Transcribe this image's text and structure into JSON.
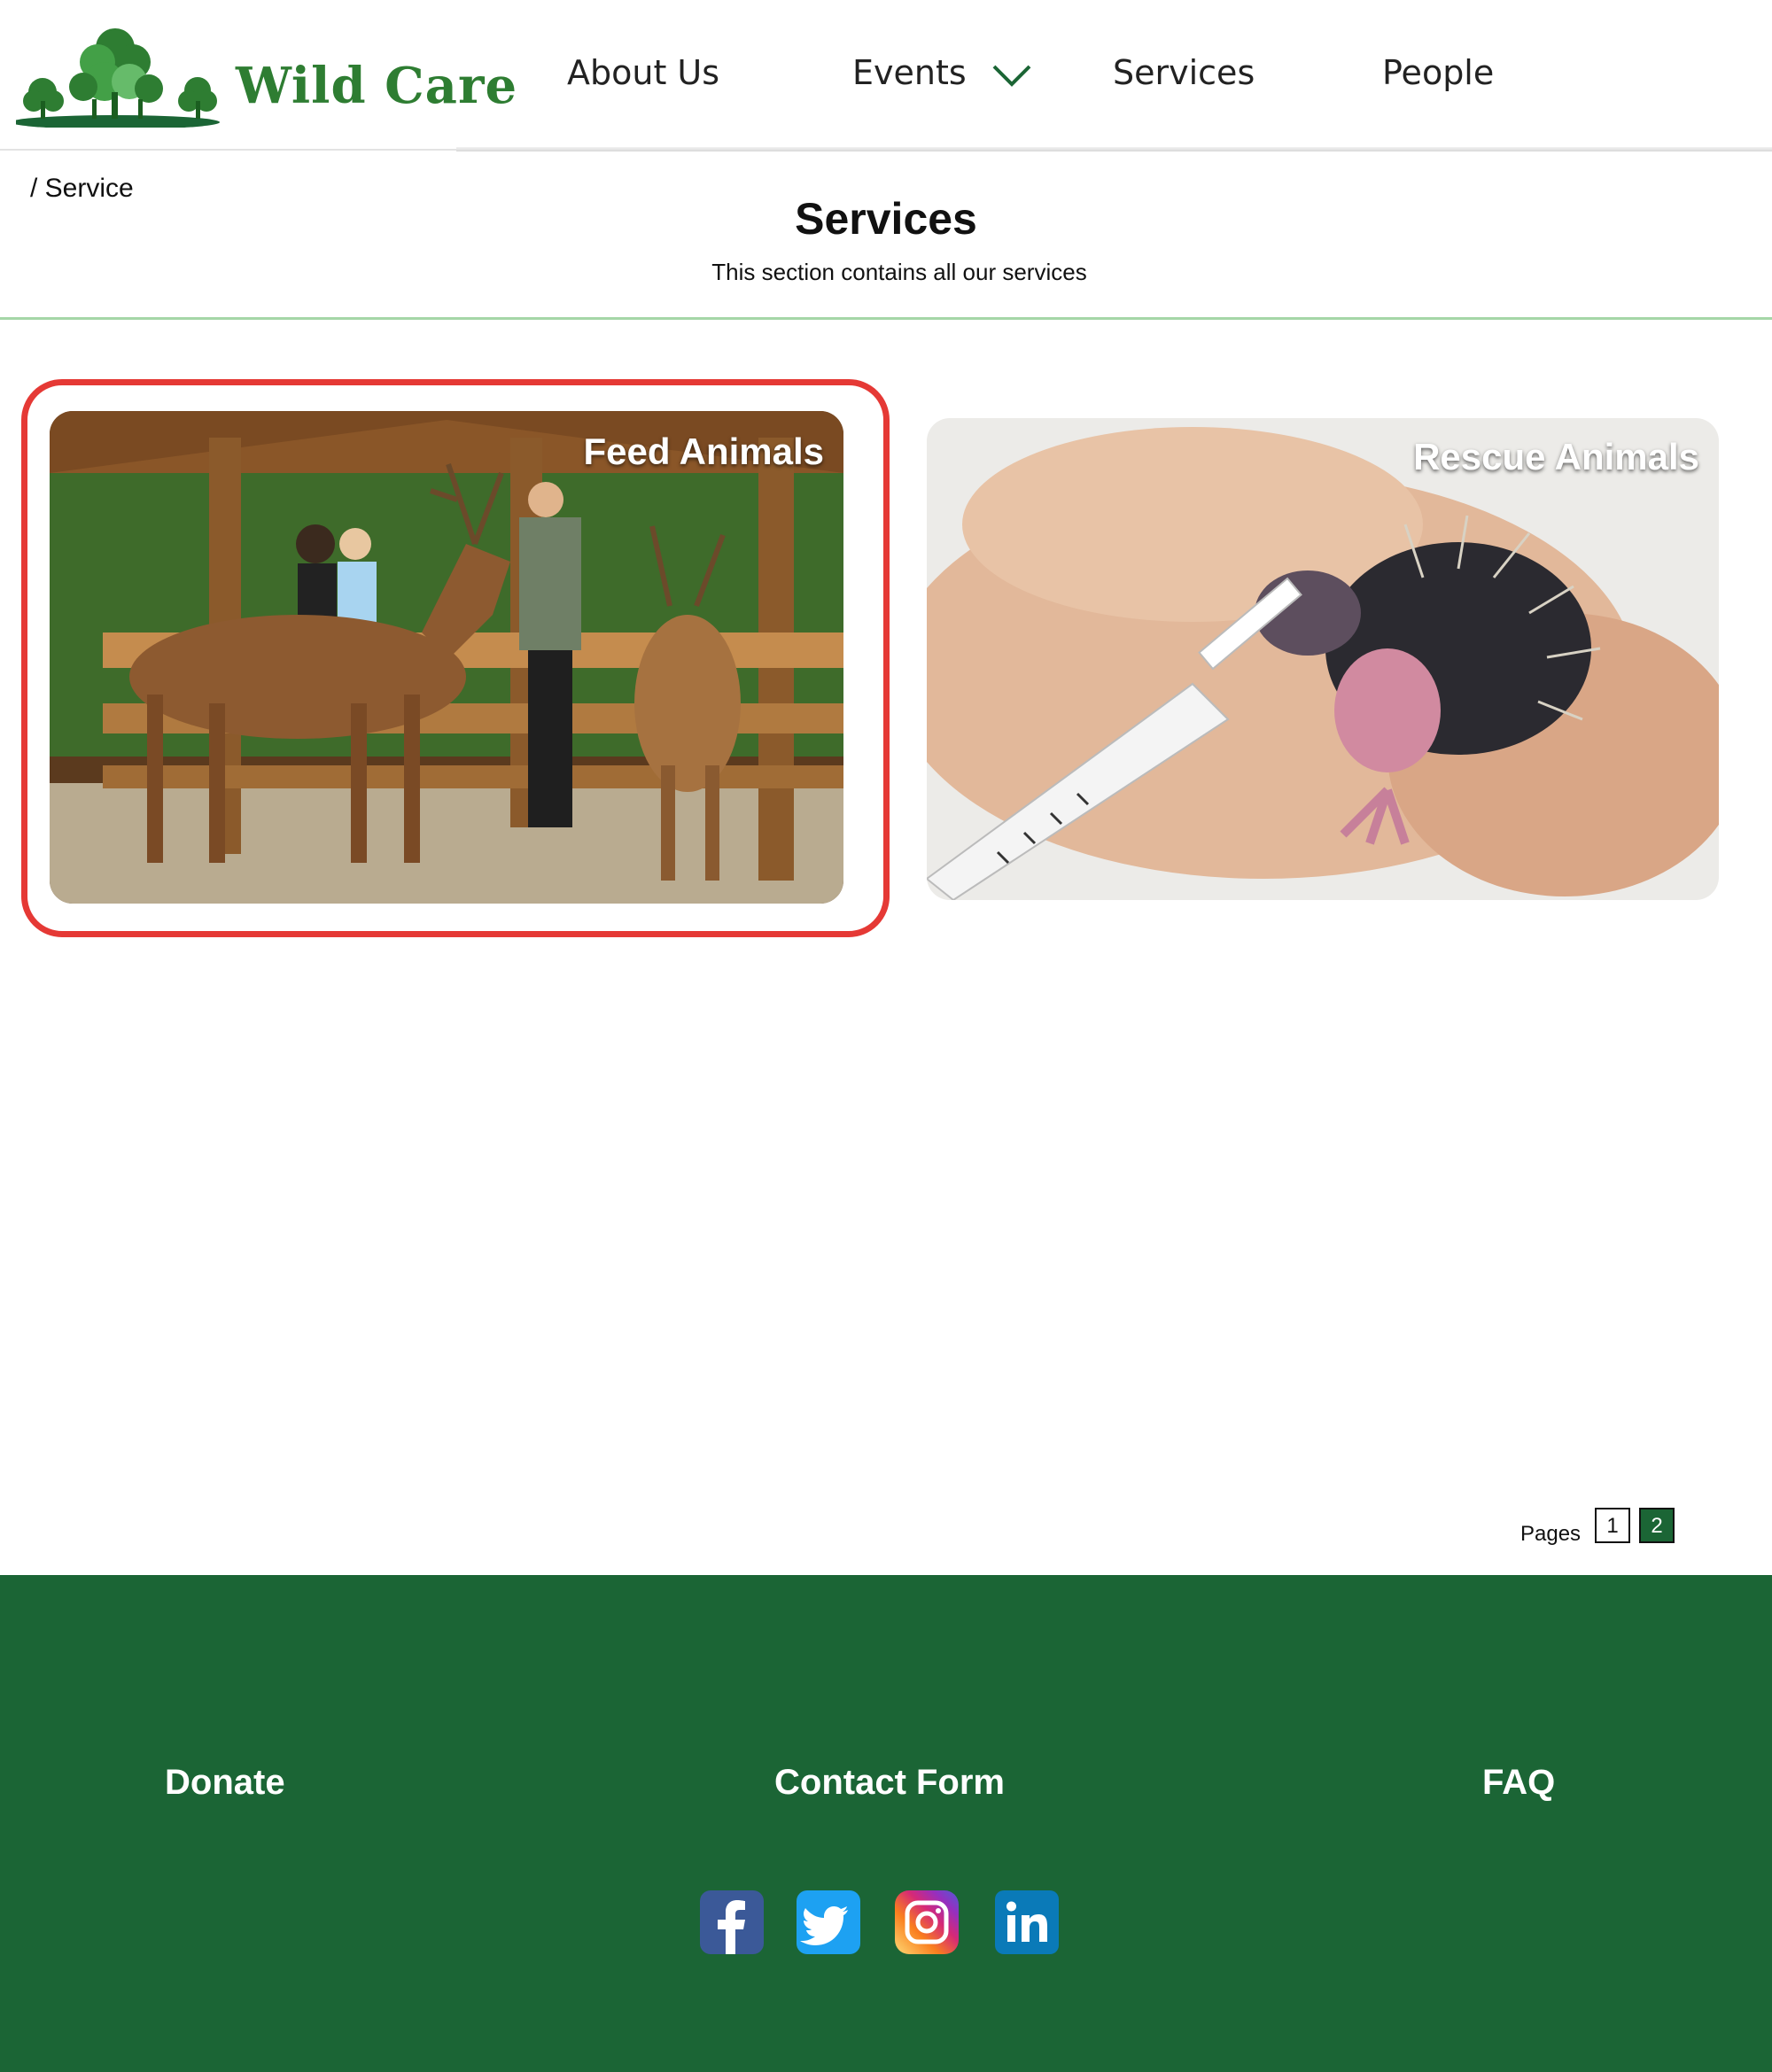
{
  "brand": {
    "name": "Wild Care",
    "colors": {
      "primary_green": "#1b6535",
      "logo_green": "#2e7d32",
      "highlight_red": "#e53935"
    }
  },
  "nav": {
    "about": "About Us",
    "events": "Events",
    "services": "Services",
    "people": "People"
  },
  "breadcrumb": "/ Service",
  "page": {
    "title": "Services",
    "subtitle": "This section contains all our services"
  },
  "cards": [
    {
      "title": "Feed Animals"
    },
    {
      "title": "Rescue Animals"
    }
  ],
  "pagination": {
    "label": "Pages",
    "pages": [
      "1",
      "2"
    ],
    "current": "2"
  },
  "footer": {
    "donate": "Donate",
    "contact": "Contact Form",
    "faq": "FAQ",
    "social_icons": [
      "facebook-icon",
      "twitter-icon",
      "instagram-icon",
      "linkedin-icon"
    ]
  }
}
